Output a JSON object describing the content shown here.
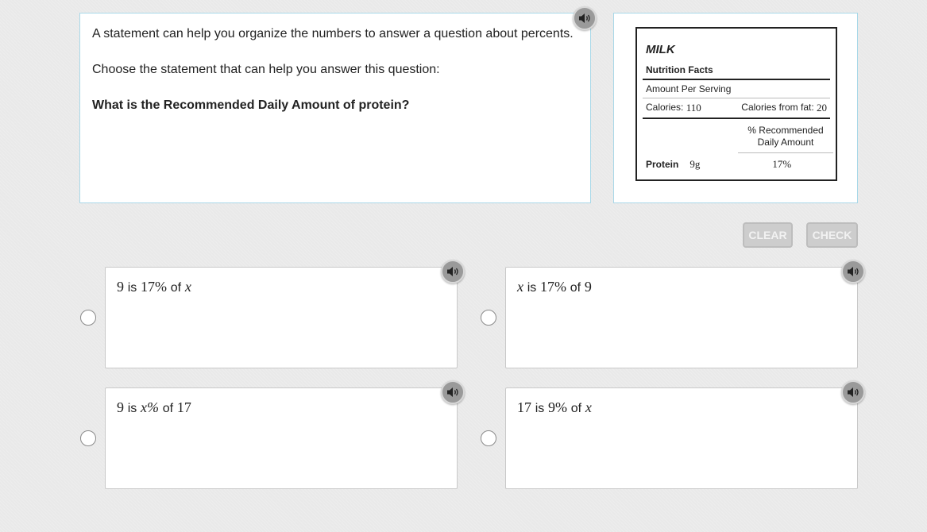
{
  "prompt": {
    "line1": "A statement can help you organize the numbers to answer a question about percents.",
    "line2": "Choose the statement that can help you answer this question:",
    "question": "What is the Recommended Daily Amount of protein?"
  },
  "nutrition_label": {
    "product": "MILK",
    "heading": "Nutrition Facts",
    "amount_per_serving": "Amount Per Serving",
    "calories_label": "Calories:",
    "calories_value": "110",
    "calories_fat_label": "Calories from fat:",
    "calories_fat_value": "20",
    "pct_header_line1": "% Recommended",
    "pct_header_line2": "Daily Amount",
    "protein_label": "Protein",
    "protein_amount": "9g",
    "protein_pct": "17%"
  },
  "buttons": {
    "clear": "CLEAR",
    "check": "CHECK"
  },
  "options": [
    {
      "a": "9",
      "w1": "is",
      "b": "17%",
      "w2": "of",
      "c": "x"
    },
    {
      "a": "x",
      "w1": "is",
      "b": "17%",
      "w2": "of",
      "c": "9"
    },
    {
      "a": "9",
      "w1": "is",
      "b": "x%",
      "w2": "of",
      "c": "17"
    },
    {
      "a": "17",
      "w1": "is",
      "b": "9%",
      "w2": "of",
      "c": "x"
    }
  ],
  "icons": {
    "audio": "speaker-icon"
  }
}
